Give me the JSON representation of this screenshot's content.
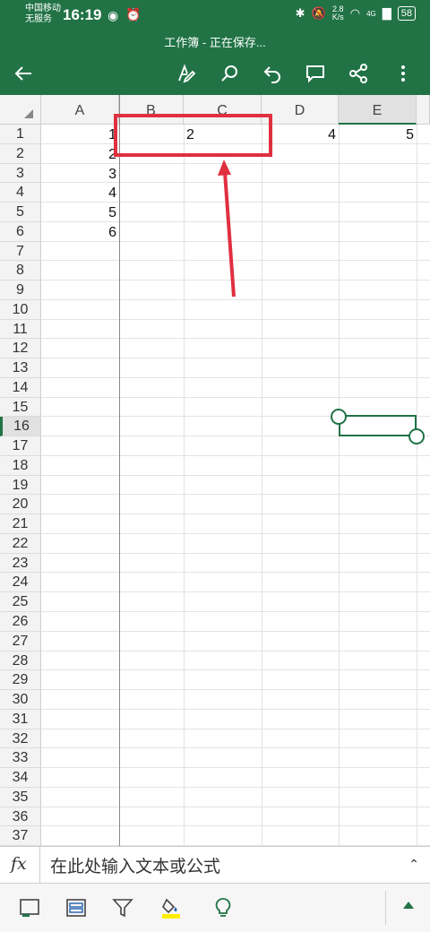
{
  "status_bar": {
    "carrier_line1": "中国移动",
    "carrier_line2": "无服务",
    "time": "16:19",
    "speed_value": "2.8",
    "speed_unit": "K/s",
    "network": "4G",
    "battery": "58"
  },
  "document": {
    "title": "工作簿 - 正在保存..."
  },
  "toolbar": {
    "back_icon": "back-arrow-icon",
    "items": [
      "draw-pen-icon",
      "search-icon",
      "undo-icon",
      "comment-icon",
      "share-icon",
      "more-icon"
    ]
  },
  "sheet": {
    "columns": [
      "A",
      "B",
      "C",
      "D",
      "E"
    ],
    "selected_column": "E",
    "rows": [
      "1",
      "2",
      "3",
      "4",
      "5",
      "6",
      "7",
      "8",
      "9",
      "10",
      "11",
      "12",
      "13",
      "14",
      "15",
      "16",
      "17",
      "18",
      "19",
      "20",
      "21",
      "22",
      "23",
      "24",
      "25",
      "26",
      "27",
      "28",
      "29",
      "30",
      "31",
      "32",
      "33",
      "34",
      "35",
      "36",
      "37"
    ],
    "selected_row": "16",
    "cells": {
      "A1": "1",
      "A2": "2",
      "A3": "3",
      "A4": "4",
      "A5": "5",
      "A6": "6",
      "B1": "2",
      "D1": "4",
      "E1": "5"
    }
  },
  "annotation": {
    "color": "#e03040"
  },
  "formula_bar": {
    "fx_label": "fx",
    "placeholder": "在此处输入文本或公式",
    "expand_icon": "chevron-up-icon"
  },
  "bottom_bar": {
    "items": [
      "sheets-view-icon",
      "card-view-icon",
      "filter-icon",
      "fill-color-icon",
      "ideas-bulb-icon"
    ],
    "fill_color": "#ffee00",
    "accent": "#217346"
  }
}
